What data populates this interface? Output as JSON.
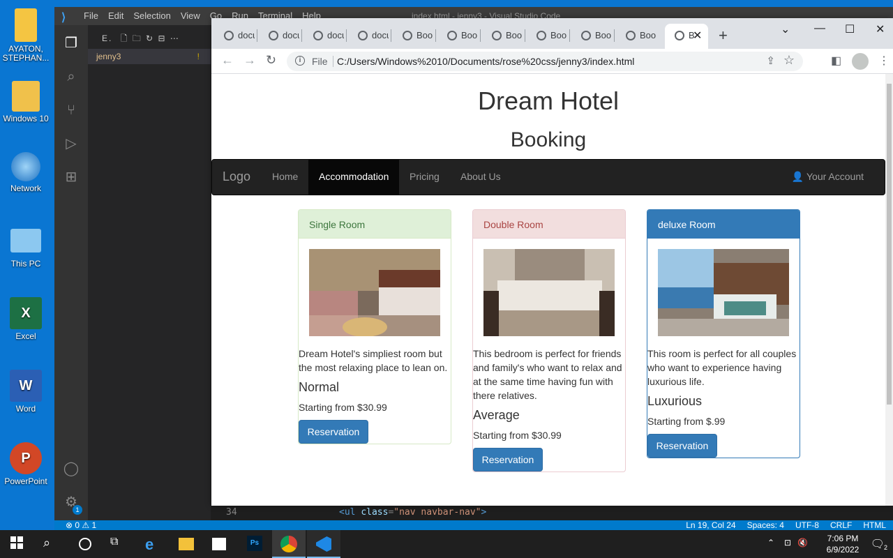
{
  "desktop": {
    "icons": [
      {
        "label": "AYATON, STEPHAN...",
        "icon": "user-folder-icon"
      },
      {
        "label": "Windows 10",
        "icon": "folder-user-icon"
      },
      {
        "label": "Network",
        "icon": "network-icon"
      },
      {
        "label": "This PC",
        "icon": "computer-icon"
      },
      {
        "label": "Excel",
        "icon": "excel-icon"
      },
      {
        "label": "Word",
        "icon": "word-icon"
      },
      {
        "label": "PowerPoint",
        "icon": "powerpoint-icon"
      }
    ]
  },
  "vscode": {
    "menu": [
      "File",
      "Edit",
      "Selection",
      "View",
      "Go",
      "Run",
      "Terminal",
      "Help"
    ],
    "title": "index.html - jenny3 - Visual Studio Code",
    "explorer_title": "E.",
    "folder": "jenny3",
    "folder_badge": "!",
    "line_number": "34",
    "code_tag": "<ul ",
    "code_attr": "class",
    "code_eq": "=",
    "code_str": "\"nav navbar-nav\"",
    "code_close": ">",
    "status_left": "⊗ 0 ⚠ 1",
    "status_right": [
      "Ln 19, Col 24",
      "Spaces: 4",
      "UTF-8",
      "CRLF",
      "HTML"
    ],
    "accounts_badge": "1"
  },
  "chrome": {
    "tabs": [
      "docu",
      "docu",
      "docu",
      "docu",
      "Boo",
      "Boo",
      "Boo",
      "Boo",
      "Boo",
      "Boo"
    ],
    "active_tab": "B",
    "url_scheme": "File",
    "url": "C:/Users/Windows%2010/Documents/rose%20css/jenny3/index.html"
  },
  "page": {
    "title": "Dream Hotel",
    "subtitle": "Booking",
    "nav": {
      "brand": "Logo",
      "items": [
        "Home",
        "Accommodation",
        "Pricing",
        "About Us"
      ],
      "active": "Accommodation",
      "account": "Your Account"
    },
    "rooms": [
      {
        "name": "Single Room",
        "description": "Dream Hotel's simpliest room but the most relaxing place to lean on.",
        "level": "Normal",
        "price": "Starting from $30.99",
        "button": "Reservation"
      },
      {
        "name": "Double Room",
        "description": "This bedroom is perfect for friends and family's who want to relax and at the same time having fun with there relatives.",
        "level": "Average",
        "price": "Starting from $30.99",
        "button": "Reservation"
      },
      {
        "name": "deluxe Room",
        "description": "This room is perfect for all couples who want to experience having luxurious life.",
        "level": "Luxurious",
        "price": "Starting from $.99",
        "button": "Reservation"
      }
    ]
  },
  "taskbar": {
    "time": "7:06 PM",
    "date": "6/9/2022",
    "notification_count": "2"
  }
}
